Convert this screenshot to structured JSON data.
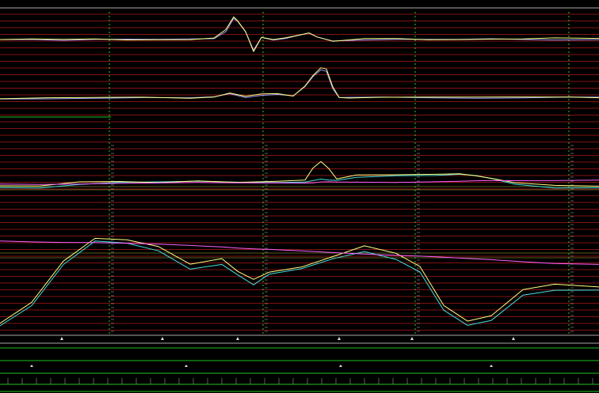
{
  "chart_data": [
    {
      "type": "line",
      "panel": "trace-1",
      "ylim": [
        -1,
        1
      ],
      "grid": true,
      "x": [
        0,
        40,
        80,
        120,
        160,
        200,
        240,
        270,
        285,
        295,
        300,
        310,
        320,
        330,
        345,
        360,
        375,
        390,
        400,
        420,
        460,
        500,
        540,
        580,
        620,
        660,
        700,
        756
      ],
      "series": [
        {
          "color": "#9a9aff",
          "values": [
            0.0,
            0.02,
            -0.02,
            0.01,
            0.0,
            -0.01,
            0.02,
            0.05,
            0.35,
            0.9,
            0.75,
            0.3,
            -0.45,
            0.1,
            0.0,
            0.05,
            0.15,
            0.25,
            0.1,
            -0.05,
            0.0,
            0.02,
            0.0,
            -0.01,
            0.02,
            0.01,
            0.0,
            0.01
          ]
        },
        {
          "color": "#ffff80",
          "values": [
            0.0,
            0.01,
            -0.01,
            0.02,
            0.0,
            0.01,
            0.0,
            0.05,
            0.4,
            0.95,
            0.8,
            0.35,
            -0.5,
            0.08,
            -0.02,
            0.06,
            0.18,
            0.3,
            0.12,
            -0.08,
            0.02,
            0.03,
            0.0,
            0.02,
            0.03,
            0.02,
            0.05,
            0.03
          ]
        }
      ]
    },
    {
      "type": "line",
      "panel": "trace-2",
      "ylim": [
        -1,
        1
      ],
      "grid": true,
      "x": [
        0,
        60,
        120,
        180,
        240,
        270,
        290,
        310,
        330,
        350,
        370,
        385,
        395,
        405,
        412,
        420,
        428,
        440,
        480,
        540,
        600,
        660,
        720,
        756
      ],
      "series": [
        {
          "color": "#9a9aff",
          "values": [
            -0.06,
            -0.04,
            -0.02,
            -0.01,
            -0.03,
            0.0,
            0.12,
            0.0,
            0.08,
            0.1,
            0.04,
            0.35,
            0.7,
            0.95,
            0.9,
            0.3,
            -0.02,
            -0.02,
            0.0,
            -0.01,
            -0.02,
            -0.01,
            0.0,
            -0.01
          ]
        },
        {
          "color": "#ffff80",
          "values": [
            -0.05,
            -0.03,
            -0.02,
            0.0,
            -0.02,
            0.02,
            0.15,
            0.02,
            0.1,
            0.12,
            0.05,
            0.4,
            0.75,
            1.0,
            0.95,
            0.35,
            0.0,
            -0.01,
            0.01,
            0.0,
            -0.01,
            0.0,
            0.01,
            0.0
          ]
        }
      ]
    },
    {
      "type": "line",
      "panel": "trace-3",
      "ylim": [
        -1,
        1
      ],
      "grid": true,
      "x": [
        0,
        50,
        100,
        150,
        200,
        250,
        300,
        350,
        385,
        395,
        405,
        415,
        425,
        450,
        500,
        550,
        580,
        600,
        620,
        650,
        700,
        756
      ],
      "series": [
        {
          "color": "#40e0e0",
          "values": [
            -0.15,
            -0.15,
            -0.05,
            0.0,
            0.0,
            0.02,
            0.0,
            0.0,
            0.02,
            0.05,
            0.08,
            0.05,
            0.05,
            0.15,
            0.2,
            0.2,
            0.22,
            0.18,
            0.1,
            -0.05,
            -0.15,
            -0.15
          ]
        },
        {
          "color": "#ffff80",
          "values": [
            -0.1,
            -0.12,
            0.0,
            0.02,
            0.0,
            0.05,
            0.0,
            0.02,
            0.05,
            0.4,
            0.6,
            0.4,
            0.1,
            0.2,
            0.2,
            0.22,
            0.25,
            0.2,
            0.12,
            -0.02,
            -0.1,
            -0.12
          ]
        },
        {
          "color": "#ff60ff",
          "values": [
            -0.05,
            -0.05,
            -0.04,
            -0.03,
            -0.03,
            -0.02,
            -0.02,
            -0.01,
            -0.01,
            -0.01,
            0.0,
            0.0,
            0.0,
            0.01,
            0.01,
            0.02,
            0.02,
            0.03,
            0.04,
            0.05,
            0.06,
            0.07
          ]
        }
      ]
    },
    {
      "type": "line",
      "panel": "trace-4",
      "ylim": [
        -1,
        1
      ],
      "grid": true,
      "x": [
        0,
        40,
        80,
        120,
        160,
        200,
        240,
        280,
        300,
        320,
        340,
        380,
        420,
        460,
        500,
        530,
        560,
        590,
        620,
        660,
        700,
        756
      ],
      "series": [
        {
          "color": "#40e0e0",
          "values": [
            -1.0,
            -0.6,
            0.2,
            0.65,
            0.6,
            0.45,
            0.1,
            0.2,
            0.0,
            -0.2,
            0.0,
            0.1,
            0.3,
            0.45,
            0.3,
            0.05,
            -0.7,
            -1.0,
            -0.9,
            -0.4,
            -0.3,
            -0.3
          ]
        },
        {
          "color": "#ffff80",
          "values": [
            -0.95,
            -0.55,
            0.25,
            0.7,
            0.68,
            0.55,
            0.2,
            0.3,
            0.05,
            -0.1,
            0.05,
            0.15,
            0.35,
            0.55,
            0.4,
            0.15,
            -0.6,
            -0.9,
            -0.8,
            -0.3,
            -0.2,
            -0.25
          ]
        },
        {
          "color": "#ff60ff",
          "values": [
            0.65,
            0.64,
            0.63,
            0.62,
            0.6,
            0.58,
            0.56,
            0.54,
            0.52,
            0.5,
            0.48,
            0.45,
            0.42,
            0.4,
            0.38,
            0.36,
            0.33,
            0.3,
            0.28,
            0.25,
            0.22,
            0.2
          ]
        }
      ]
    }
  ],
  "colors": {
    "background": "#000000",
    "grid_red": "#b01818",
    "grid_white": "#e0e0e0",
    "grid_green": "#20c020",
    "marker_green": "#30ff30",
    "accent_yellow": "#ffff60"
  }
}
